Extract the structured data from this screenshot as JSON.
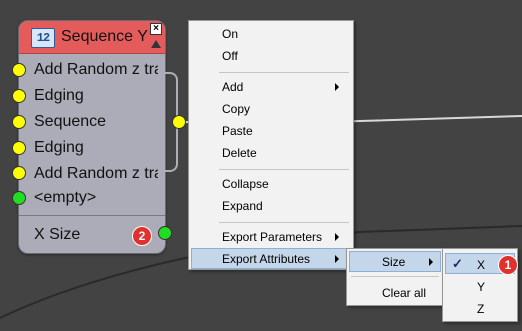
{
  "node": {
    "title": "Sequence Y",
    "icon_text": "12",
    "inputs": [
      "Add Random z tra",
      "Edging",
      "Sequence",
      "Edging",
      "Add Random z tra",
      "<empty>"
    ],
    "output_label": "X Size",
    "output_badge": "2"
  },
  "context_menu": {
    "on": "On",
    "off": "Off",
    "add": "Add",
    "copy": "Copy",
    "paste": "Paste",
    "delete": "Delete",
    "collapse": "Collapse",
    "expand": "Expand",
    "export_parameters": "Export Parameters",
    "export_attributes": "Export Attributes"
  },
  "attributes_menu": {
    "size": "Size",
    "clear_all": "Clear all"
  },
  "size_menu": {
    "check": "✓",
    "x": "X",
    "x_badge": "1",
    "y": "Y",
    "z": "Z"
  },
  "colors": {
    "background": "#434343",
    "node_header": "#e45b5b",
    "node_body": "#acacb8",
    "port_yellow": "#ffff00",
    "port_green": "#22dd22",
    "badge_red": "#e0312f",
    "menu_highlight": "#c4d6ea"
  }
}
